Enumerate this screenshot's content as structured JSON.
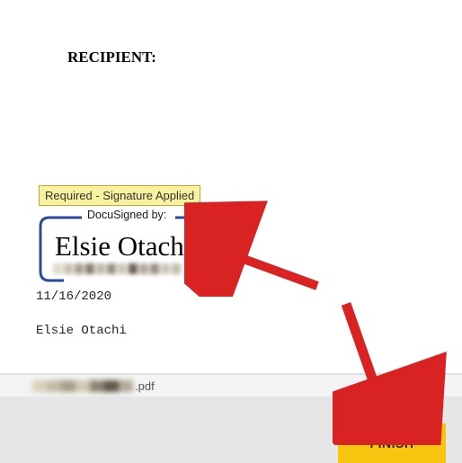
{
  "document": {
    "recipient_label": "RECIPIENT:",
    "status_badge": "Required - Signature Applied",
    "signature_box_label": "DocuSigned by:",
    "signature_name": "Elsie Otachi",
    "date": "11/16/2020",
    "printed_name": "Elsie Otachi"
  },
  "footer": {
    "file_extension": ".pdf",
    "finish_button": "FINISH"
  },
  "colors": {
    "finish_bg": "#f7c50f",
    "badge_bg": "#f7f2a0",
    "arrow": "#d92323"
  }
}
